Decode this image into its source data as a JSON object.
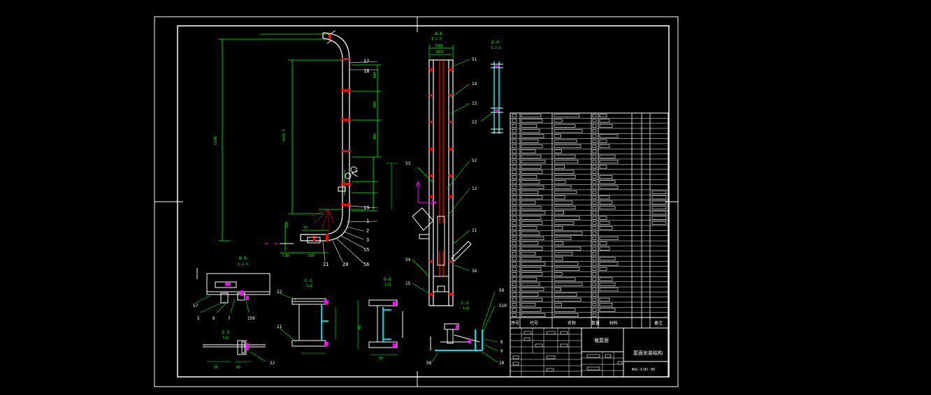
{
  "colors": {
    "background": "#000000",
    "frame": "#ffffff",
    "dimension": "#00ff00",
    "hatch": "#ff0000",
    "outline": "#ffffff",
    "section": "#00ffff",
    "axis": "#ff00ff",
    "highlight": "#ff00ff"
  },
  "main_view": {
    "callouts": [
      "17",
      "18",
      "19",
      "1",
      "2",
      "3",
      "55",
      "56",
      "20",
      "21"
    ],
    "dimensions": [
      "5100",
      "3972.5",
      "100",
      "100",
      "100",
      "120",
      "170",
      "70",
      "150"
    ]
  },
  "middle_view": {
    "section_title": "A-A",
    "scale": "1:2.5",
    "dimensions": [
      "1500",
      "1451"
    ],
    "callouts": [
      "51",
      "14",
      "13",
      "52",
      "53",
      "12",
      "11",
      "16",
      "54",
      "15"
    ]
  },
  "pp_view": {
    "title": "P-P",
    "scale": "1:2.5",
    "callouts": [
      "23"
    ]
  },
  "bb_view": {
    "title": "B-B",
    "scale": "1:2.5",
    "callouts": [
      "57",
      "6",
      "5",
      "7",
      "150"
    ]
  },
  "cc_view": {
    "title": "C-C",
    "scale": "1:2",
    "callouts": [
      "22",
      "21"
    ]
  },
  "dd_view": {
    "title": "D-D",
    "scale": "1:2",
    "callouts": [
      "40",
      "50"
    ]
  },
  "ee_view": {
    "title": "E-E",
    "scale": "1:2",
    "callouts": [
      "22",
      "60",
      "50"
    ]
  },
  "ff_view": {
    "title": "C-C",
    "scale": "1:2",
    "callouts": [
      "59",
      "510",
      "8",
      "9",
      "10",
      "58"
    ]
  },
  "bom": {
    "header": [
      "序号",
      "代号",
      "名称",
      "数量",
      "材料",
      "",
      "备注"
    ]
  },
  "title_block": {
    "title": "坡屋面",
    "drawing_name": "屋面安装结构",
    "drawing_number": "WSC-X(W)-00"
  }
}
